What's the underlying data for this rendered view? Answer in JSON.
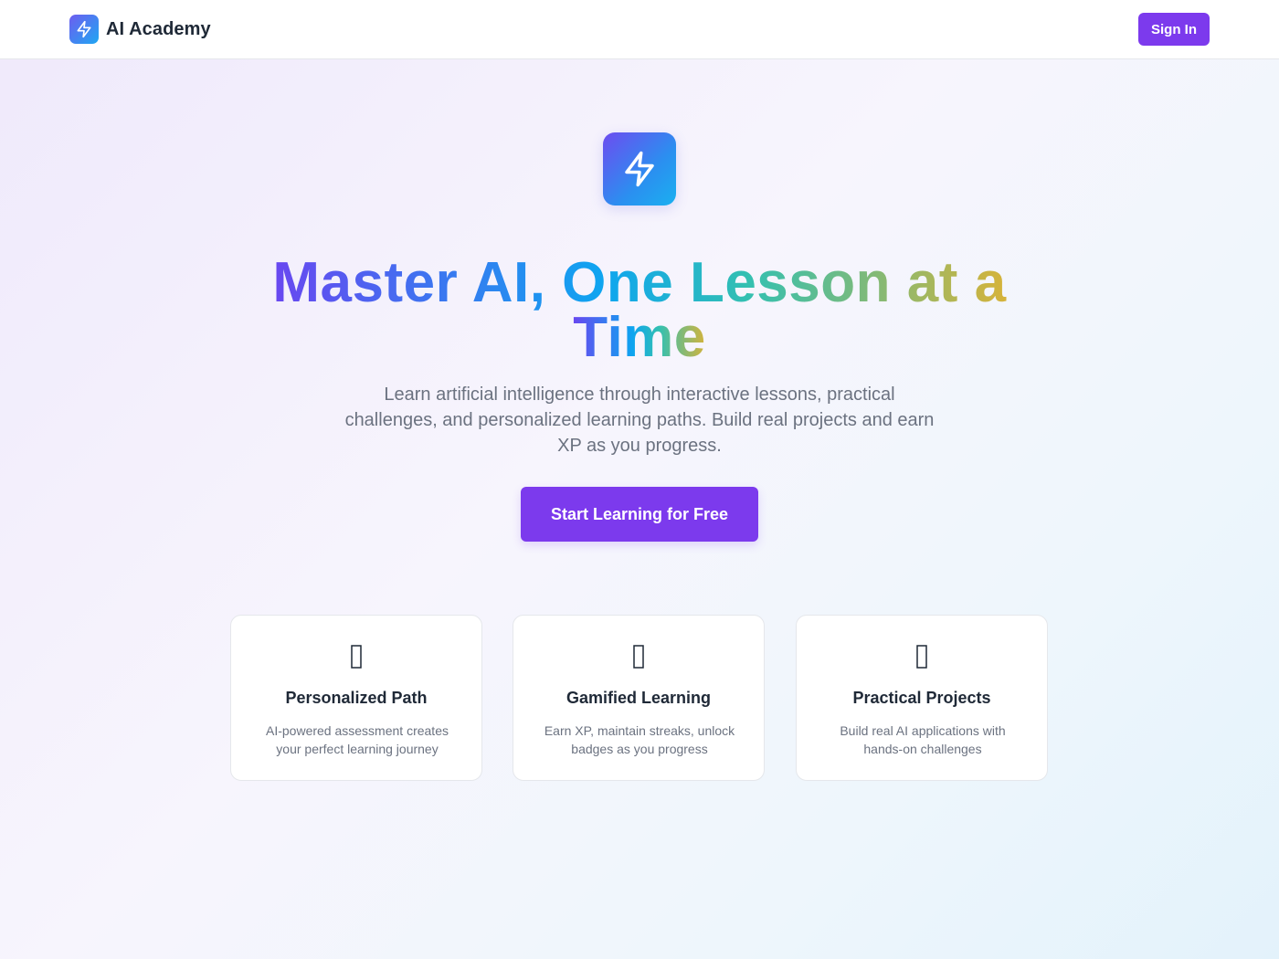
{
  "header": {
    "brand_name": "AI Academy",
    "brand_icon": "lightning-bolt-icon",
    "signin_label": "Sign In"
  },
  "hero": {
    "icon": "lightning-bolt-icon",
    "headline_line1": "Master AI, One Lesson at a",
    "headline_line2": "Time",
    "subtitle": "Learn artificial intelligence through interactive lessons, practical challenges, and personalized learning paths. Build real projects and earn XP as you progress.",
    "cta_label": "Start Learning for Free"
  },
  "features": [
    {
      "icon": "missing-glyph-icon",
      "title": "Personalized Path",
      "description": "AI-powered assessment creates your perfect learning journey"
    },
    {
      "icon": "missing-glyph-icon",
      "title": "Gamified Learning",
      "description": "Earn XP, maintain streaks, unlock badges as you progress"
    },
    {
      "icon": "missing-glyph-icon",
      "title": "Practical Projects",
      "description": "Build real AI applications with hands-on challenges"
    }
  ],
  "colors": {
    "primary": "#7c3aed",
    "gradient_start": "#6947f0",
    "gradient_mid": "#0ea5f0",
    "gradient_end": "#d6b33a",
    "text_dark": "#1f2937",
    "text_muted": "#6b7280"
  }
}
